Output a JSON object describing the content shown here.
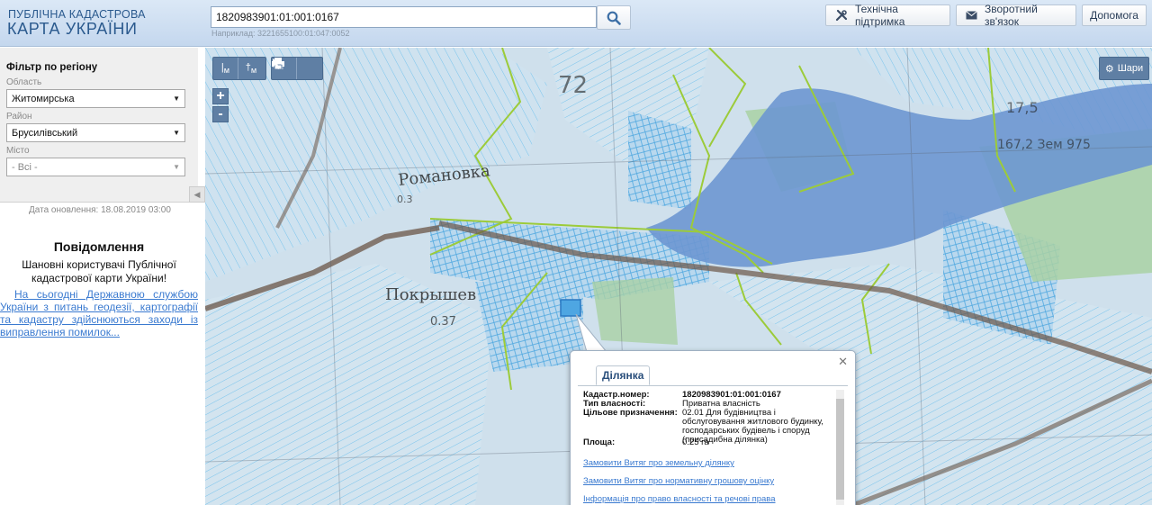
{
  "header": {
    "logo_top": "ПУБЛІЧНА КАДАСТРОВА",
    "logo_bottom": "КАРТА УКРАЇНИ",
    "search_value": "1820983901:01:001:0167",
    "search_hint": "Наприклад: 3221655100:01:047:0052",
    "search_icon": "search-icon",
    "buttons": [
      {
        "label": "Технічна підтримка",
        "icon": "tools-icon"
      },
      {
        "label": "Зворотний зв'язок",
        "icon": "mail-icon"
      },
      {
        "label": "Допомога"
      }
    ]
  },
  "sidebar": {
    "filter_title": "Фільтр по регіону",
    "oblast_label": "Область",
    "oblast_value": "Житомирська",
    "rayon_label": "Район",
    "rayon_value": "Брусилівський",
    "misto_label": "Місто",
    "misto_value": "- Всі -",
    "update_date": "Дата оновлення: 18.08.2019 03:00",
    "notice_title": "Повідомлення",
    "notice_greeting": "Шановні користувачі Публічної кадастрової карти України!",
    "notice_link": "На сьогодні Державною службою України з питань геодезії, картографії та кадастру здійснюються заходи із виправлення помилок..."
  },
  "map": {
    "zoom_in": "+",
    "zoom_out": "-",
    "layers_label": "Шари",
    "labels": [
      "Романовка",
      "Покрышев",
      "0.37",
      "72",
      "17,5",
      "167,2 Зем 975",
      "0.3"
    ],
    "colors": {
      "water": "#6f98d2",
      "parcel": "#7fc8f0",
      "boundary": "#9ccc3c",
      "forest": "#a6cf9e"
    }
  },
  "popup": {
    "tab_label": "Ділянка",
    "rows": [
      {
        "key": "Кадастр.номер:",
        "value": "1820983901:01:001:0167"
      },
      {
        "key": "Тип власності:",
        "value": "Приватна власність"
      },
      {
        "key": "Цільове призначення:",
        "value": "02.01 Для будівництва і обслуговування житлового будинку, господарських будівель і споруд (присадибна ділянка)"
      },
      {
        "key": "Площа:",
        "value": "0.25 га"
      }
    ],
    "links": [
      "Замовити Витяг про земельну ділянку",
      "Замовити Витяг про нормативну грошову оцінку",
      "Інформація про право власності та речові права"
    ]
  }
}
